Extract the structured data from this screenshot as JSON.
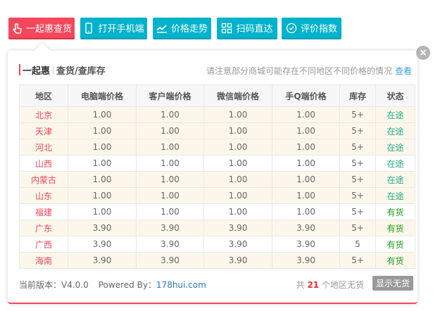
{
  "toolbar": {
    "buttons": [
      {
        "label": "一起惠查货",
        "icon": "hand-pointer-icon",
        "color": "#f5475b"
      },
      {
        "label": "打开手机端",
        "icon": "phone-icon",
        "color": "#00b2cb"
      },
      {
        "label": "价格走势",
        "icon": "trend-icon",
        "color": "#00b2cb"
      },
      {
        "label": "扫码直达",
        "icon": "qrcode-icon",
        "color": "#00b2cb"
      },
      {
        "label": "评价指数",
        "icon": "check-circle-icon",
        "color": "#00b2cb"
      }
    ]
  },
  "panel": {
    "brand": "一起惠",
    "subtitle": "查货/查库存",
    "notice": "请注意部分商城可能存在不同地区不同价格的情况",
    "notice_link": "查看",
    "close": "×"
  },
  "table": {
    "headers": [
      "地区",
      "电脑端价格",
      "客户端价格",
      "微信端价格",
      "手Q端价格",
      "库存",
      "状态"
    ],
    "rows": [
      [
        "北京",
        "1.00",
        "1.00",
        "1.00",
        "1.00",
        "5+",
        "在途"
      ],
      [
        "天津",
        "1.00",
        "1.00",
        "1.00",
        "1.00",
        "5+",
        "在途"
      ],
      [
        "河北",
        "1.00",
        "1.00",
        "1.00",
        "1.00",
        "5+",
        "在途"
      ],
      [
        "山西",
        "1.00",
        "1.00",
        "1.00",
        "1.00",
        "5+",
        "在途"
      ],
      [
        "内蒙古",
        "1.00",
        "1.00",
        "1.00",
        "1.00",
        "5+",
        "在途"
      ],
      [
        "山东",
        "1.00",
        "1.00",
        "1.00",
        "1.00",
        "5+",
        "在途"
      ],
      [
        "福建",
        "1.00",
        "1.00",
        "1.00",
        "1.00",
        "5+",
        "有货"
      ],
      [
        "广东",
        "3.90",
        "3.90",
        "3.90",
        "3.90",
        "5+",
        "有货"
      ],
      [
        "广西",
        "3.90",
        "3.90",
        "3.90",
        "3.90",
        "5",
        "有货"
      ],
      [
        "海南",
        "3.90",
        "3.90",
        "3.90",
        "3.90",
        "5+",
        "有货"
      ]
    ],
    "highlighted": [
      true,
      true,
      true,
      false,
      true,
      true,
      false,
      true,
      false,
      true
    ]
  },
  "footer": {
    "version": "当前版本：V4.0.0",
    "powered": "Powered By：",
    "site": "178hui.com",
    "count_prefix": "共",
    "count": "21",
    "count_suffix": "个地区无货",
    "show_button": "显示无货"
  }
}
